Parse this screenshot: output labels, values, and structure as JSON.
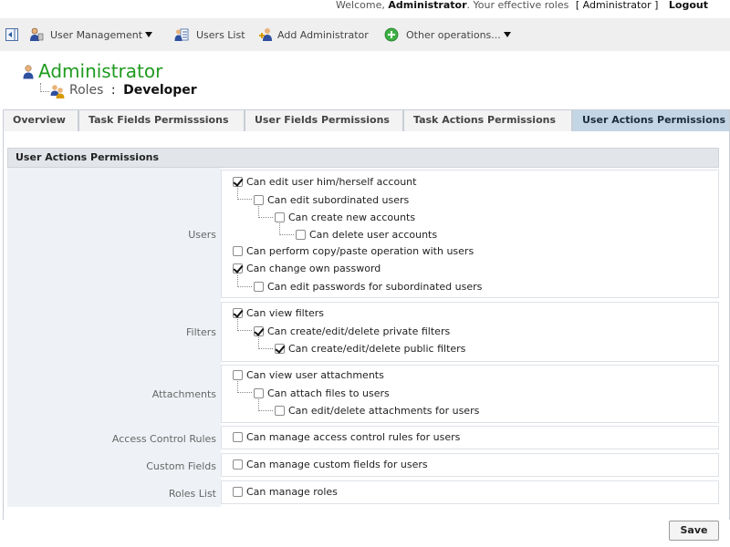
{
  "top": {
    "welcome_prefix": "Welcome,",
    "user": "Administrator",
    "roles_text": ". Your effective roles",
    "role_bracket": "[ Administrator ]",
    "logout": "Logout"
  },
  "nav": {
    "user_management": "User Management",
    "users_list": "Users List",
    "add_administrator": "Add Administrator",
    "other_operations": "Other operations..."
  },
  "header": {
    "name": "Administrator",
    "roles_label": "Roles",
    "separator": ":",
    "role": "Developer"
  },
  "tabs": [
    "Overview",
    "Task Fields Permisssions",
    "User Fields Permissions",
    "Task Actions Permissions",
    "User Actions Permissions"
  ],
  "active_tab": 4,
  "section_title": "User Actions Permissions",
  "groups": [
    {
      "label": "Users",
      "items": [
        {
          "text": "Can edit user him/herself account",
          "checked": true,
          "level": 0
        },
        {
          "text": "Can edit subordinated users",
          "checked": false,
          "level": 1
        },
        {
          "text": "Can create new accounts",
          "checked": false,
          "level": 2
        },
        {
          "text": "Can delete user accounts",
          "checked": false,
          "level": 3
        },
        {
          "text": "Can perform copy/paste operation with users",
          "checked": false,
          "level": 0
        },
        {
          "text": "Can change own password",
          "checked": true,
          "level": 0
        },
        {
          "text": "Can edit passwords for subordinated users",
          "checked": false,
          "level": 1
        }
      ]
    },
    {
      "label": "Filters",
      "items": [
        {
          "text": "Can view filters",
          "checked": true,
          "level": 0
        },
        {
          "text": "Can create/edit/delete private filters",
          "checked": true,
          "level": 1
        },
        {
          "text": "Can create/edit/delete public filters",
          "checked": true,
          "level": 2
        }
      ]
    },
    {
      "label": "Attachments",
      "items": [
        {
          "text": "Can view user attachments",
          "checked": false,
          "level": 0
        },
        {
          "text": "Can attach files to users",
          "checked": false,
          "level": 1
        },
        {
          "text": "Can edit/delete attachments for users",
          "checked": false,
          "level": 2
        }
      ]
    },
    {
      "label": "Access Control Rules",
      "items": [
        {
          "text": "Can manage access control rules for users",
          "checked": false,
          "level": 0
        }
      ]
    },
    {
      "label": "Custom Fields",
      "items": [
        {
          "text": "Can manage custom fields for users",
          "checked": false,
          "level": 0
        }
      ]
    },
    {
      "label": "Roles List",
      "items": [
        {
          "text": "Can manage roles",
          "checked": false,
          "level": 0
        }
      ]
    }
  ],
  "save_label": "Save",
  "colors": {
    "title_green": "#1f9b1f",
    "active_tab_bg": "#c3d6e6",
    "label_column_bg": "#eef2f6"
  },
  "icons": {
    "back": "back-icon",
    "user_management": "user-management-icon",
    "users_list": "users-list-icon",
    "add_administrator": "add-administrator-icon",
    "other_operations": "add-circle-icon",
    "user": "user-icon",
    "roles": "roles-icon"
  }
}
